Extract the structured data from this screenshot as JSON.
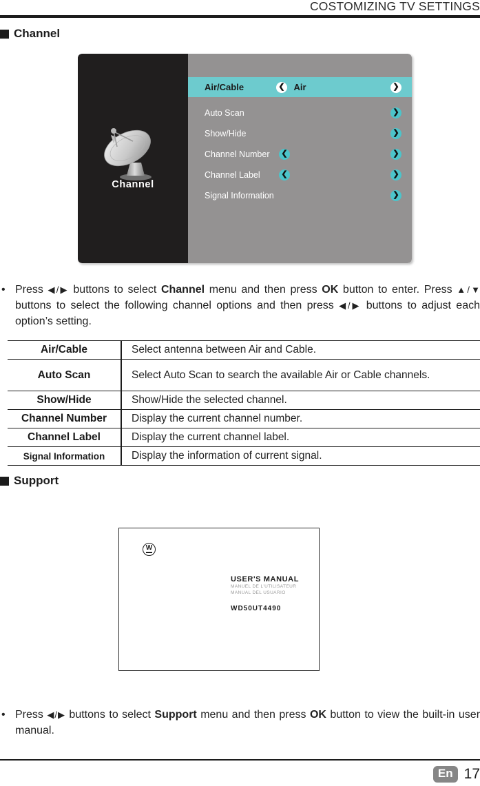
{
  "header": {
    "title": "COSTOMIZING TV SETTINGS"
  },
  "sections": {
    "channel": {
      "label": "Channel",
      "bullet_icon": "square-bullet-icon"
    },
    "support": {
      "label": "Support",
      "bullet_icon": "square-bullet-icon"
    }
  },
  "osd": {
    "left_panel": {
      "icon": "satellite-dish-icon",
      "label": "Channel"
    },
    "rows": [
      {
        "label": "Air/Cable",
        "value": "Air",
        "selected": true,
        "left_arrow": true,
        "right_arrow": true
      },
      {
        "label": "Auto Scan",
        "value": "",
        "selected": false,
        "left_arrow": false,
        "right_arrow": true
      },
      {
        "label": "Show/Hide",
        "value": "",
        "selected": false,
        "left_arrow": false,
        "right_arrow": true
      },
      {
        "label": "Channel Number",
        "value": "",
        "selected": false,
        "left_arrow": true,
        "right_arrow": true
      },
      {
        "label": "Channel Label",
        "value": "",
        "selected": false,
        "left_arrow": true,
        "right_arrow": true
      },
      {
        "label": "Signal Information",
        "value": "",
        "selected": false,
        "left_arrow": false,
        "right_arrow": true
      }
    ],
    "colors": {
      "highlight": "#6dcbce",
      "panel_bg": "#949292",
      "left_bg": "#201e1e",
      "arrow_teal": "#4cc4ca"
    }
  },
  "channel_paragraph": {
    "bullet": "•",
    "seg1": "Press ",
    "glyph_lr_1": "◀/▶",
    "seg2": " buttons to select ",
    "bold1": "Channel",
    "seg3": " menu and then press ",
    "bold2": "OK",
    "seg4": " button to enter. Press ",
    "glyph_ud": "▲/▼",
    "seg5": " buttons to select the following channel options and then press ",
    "glyph_lr_2": "◀/▶",
    "seg6": " buttons to adjust each option’s setting."
  },
  "table": {
    "rows": [
      {
        "option": "Air/Cable",
        "description": "Select antenna between Air and Cable.",
        "small": false,
        "tall": false
      },
      {
        "option": "Auto Scan",
        "description": "Select Auto Scan to search the available Air or Cable channels.",
        "small": false,
        "tall": true
      },
      {
        "option": "Show/Hide",
        "description": "Show/Hide the selected channel.",
        "small": false,
        "tall": false
      },
      {
        "option": "Channel Number",
        "description": "Display the current channel number.",
        "small": false,
        "tall": false
      },
      {
        "option": "Channel Label",
        "description": "Display the current channel label.",
        "small": false,
        "tall": false
      },
      {
        "option": "Signal Information",
        "description": "Display the information of current signal.",
        "small": true,
        "tall": false
      }
    ]
  },
  "manual_cover": {
    "logo_icon": "westinghouse-w-logo-icon",
    "logo_letter": "W",
    "title_en": "USER'S MANUAL",
    "title_fr": "MANUEL DE L'UTILISATEUR",
    "title_es": "MANUAL DEL USUARIO",
    "model": "WD50UT4490"
  },
  "support_paragraph": {
    "bullet": "•",
    "seg1": "Press ",
    "glyph_lr_1": "◀/▶",
    "seg2": " buttons to select ",
    "bold1": "Support",
    "seg3": " menu and then press ",
    "bold2": "OK",
    "seg4": " button to view the built-in user manual."
  },
  "footer": {
    "language": "En",
    "page_number": "17"
  }
}
